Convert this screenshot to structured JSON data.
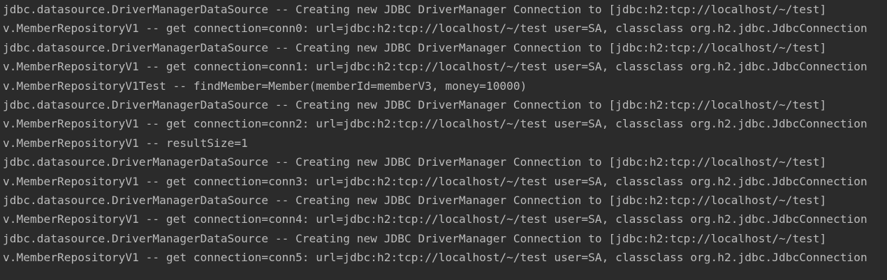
{
  "console": {
    "lines": [
      "jdbc.datasource.DriverManagerDataSource -- Creating new JDBC DriverManager Connection to [jdbc:h2:tcp://localhost/~/test]",
      "v.MemberRepositoryV1 -- get connection=conn0: url=jdbc:h2:tcp://localhost/~/test user=SA, classclass org.h2.jdbc.JdbcConnection",
      "jdbc.datasource.DriverManagerDataSource -- Creating new JDBC DriverManager Connection to [jdbc:h2:tcp://localhost/~/test]",
      "v.MemberRepositoryV1 -- get connection=conn1: url=jdbc:h2:tcp://localhost/~/test user=SA, classclass org.h2.jdbc.JdbcConnection",
      "v.MemberRepositoryV1Test -- findMember=Member(memberId=memberV3, money=10000)",
      "jdbc.datasource.DriverManagerDataSource -- Creating new JDBC DriverManager Connection to [jdbc:h2:tcp://localhost/~/test]",
      "v.MemberRepositoryV1 -- get connection=conn2: url=jdbc:h2:tcp://localhost/~/test user=SA, classclass org.h2.jdbc.JdbcConnection",
      "v.MemberRepositoryV1 -- resultSize=1",
      "jdbc.datasource.DriverManagerDataSource -- Creating new JDBC DriverManager Connection to [jdbc:h2:tcp://localhost/~/test]",
      "v.MemberRepositoryV1 -- get connection=conn3: url=jdbc:h2:tcp://localhost/~/test user=SA, classclass org.h2.jdbc.JdbcConnection",
      "jdbc.datasource.DriverManagerDataSource -- Creating new JDBC DriverManager Connection to [jdbc:h2:tcp://localhost/~/test]",
      "v.MemberRepositoryV1 -- get connection=conn4: url=jdbc:h2:tcp://localhost/~/test user=SA, classclass org.h2.jdbc.JdbcConnection",
      "jdbc.datasource.DriverManagerDataSource -- Creating new JDBC DriverManager Connection to [jdbc:h2:tcp://localhost/~/test]",
      "v.MemberRepositoryV1 -- get connection=conn5: url=jdbc:h2:tcp://localhost/~/test user=SA, classclass org.h2.jdbc.JdbcConnection"
    ]
  }
}
